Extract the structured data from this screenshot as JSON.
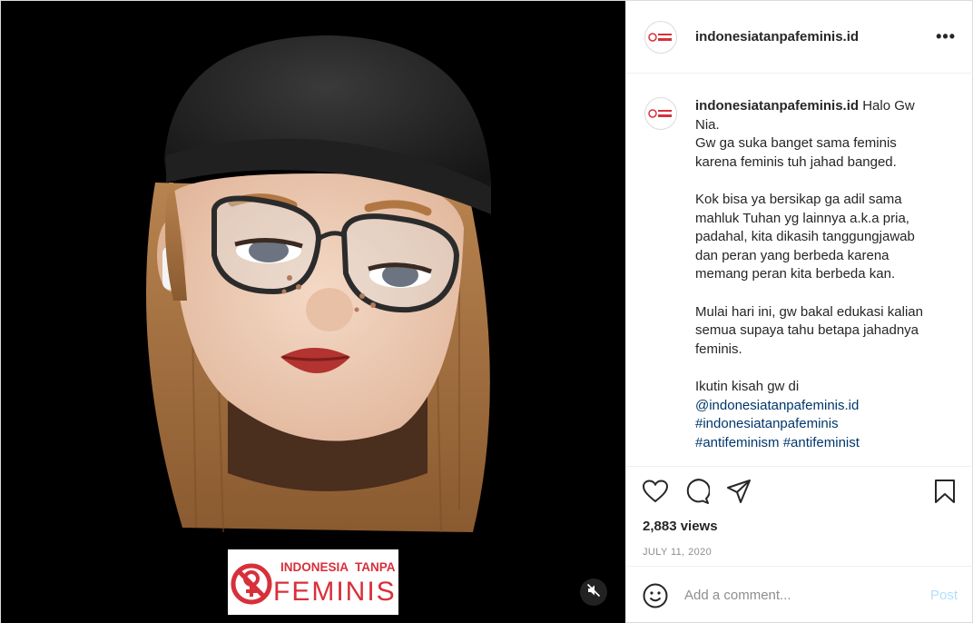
{
  "post": {
    "username": "indonesiatanpafeminis.id",
    "caption_lines": [
      "Gw ga suka banget sama feminis",
      "karena feminis tuh jahad banged."
    ],
    "caption_first": "Halo Gw",
    "caption_first_cont": "Nia.",
    "paragraph2": [
      "Kok bisa ya bersikap ga adil sama",
      "mahluk Tuhan yg lainnya a.k.a pria,",
      "padahal, kita dikasih tanggungjawab",
      "dan peran yang berbeda karena",
      "memang peran kita berbeda kan."
    ],
    "paragraph3": [
      "Mulai hari ini, gw bakal edukasi kalian",
      "semua supaya tahu betapa jahadnya",
      "feminis."
    ],
    "paragraph4_intro": "Ikutin kisah gw di",
    "mention": "@indonesiatanpafeminis.id",
    "hashtag1": "#indonesiatanpafeminis",
    "hashtag2": "#antifeminism",
    "hashtag3": "#antifeminist",
    "views": "2,883 views",
    "date": "JULY 11, 2020"
  },
  "comment": {
    "placeholder": "Add a comment...",
    "post_label": "Post"
  },
  "logo_banner": {
    "line1_a": "INDONESIA",
    "line1_b": "TANPA",
    "line2": "FEMINIS"
  },
  "colors": {
    "brand_red": "#d8303a",
    "link_blue": "#00376b",
    "post_disabled": "#b2dffc"
  },
  "icons": {
    "more": "more-options-icon",
    "like": "heart-icon",
    "comment": "comment-bubble-icon",
    "share": "paper-plane-icon",
    "save": "bookmark-icon",
    "emoji": "smiley-icon",
    "mute": "speaker-muted-icon"
  }
}
